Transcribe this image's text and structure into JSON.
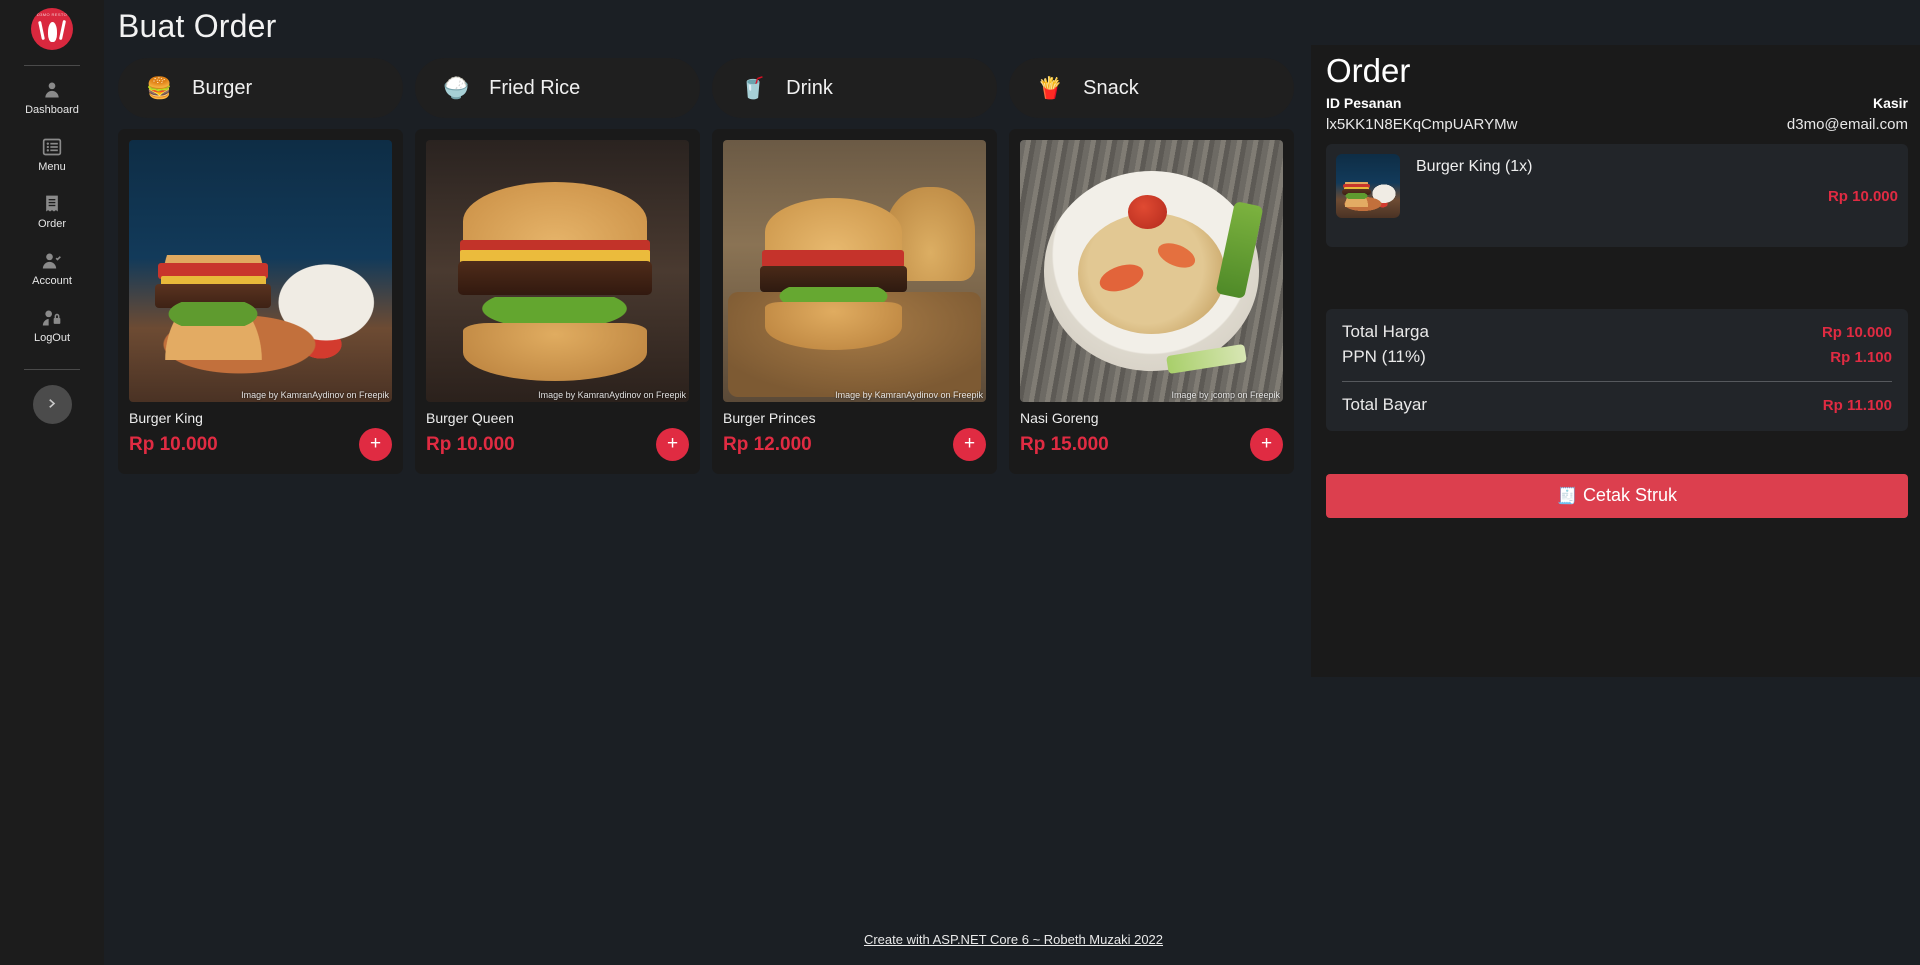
{
  "sidebar": {
    "logo_name": "restaurant-logo",
    "logo_arc_text": "D3MO RESTO",
    "items": [
      {
        "label": "Dashboard",
        "icon": "user-icon"
      },
      {
        "label": "Menu",
        "icon": "list-icon"
      },
      {
        "label": "Order",
        "icon": "receipt-icon"
      },
      {
        "label": "Account",
        "icon": "user-check-icon"
      },
      {
        "label": "LogOut",
        "icon": "user-lock-icon"
      }
    ],
    "collapse_icon": "chevron-right-icon"
  },
  "page": {
    "title": "Buat Order"
  },
  "categories": [
    {
      "label": "Burger",
      "emoji": "🍔",
      "icon": "burger-icon"
    },
    {
      "label": "Fried Rice",
      "emoji": "🍚",
      "icon": "fried-rice-icon"
    },
    {
      "label": "Drink",
      "emoji": "🥤",
      "icon": "drink-icon"
    },
    {
      "label": "Snack",
      "emoji": "🍟",
      "icon": "snack-icon"
    }
  ],
  "products": [
    {
      "name": "Burger King",
      "price": "Rp 10.000",
      "credit": "Image by KamranAydinov on Freepik",
      "add_label": "+"
    },
    {
      "name": "Burger Queen",
      "price": "Rp 10.000",
      "credit": "Image by KamranAydinov on Freepik",
      "add_label": "+"
    },
    {
      "name": "Burger Princes",
      "price": "Rp 12.000",
      "credit": "Image by KamranAydinov on Freepik",
      "add_label": "+"
    },
    {
      "name": "Nasi Goreng",
      "price": "Rp 15.000",
      "credit": "Image by jcomp on Freepik",
      "add_label": "+"
    }
  ],
  "order": {
    "title": "Order",
    "id_label": "ID Pesanan",
    "id_value": "lx5KK1N8EKqCmpUARYMw",
    "role_label": "Kasir",
    "role_email": "d3mo@email.com",
    "items": [
      {
        "name": "Burger King (1x)",
        "price": "Rp 10.000"
      }
    ],
    "totals": {
      "subtotal_label": "Total Harga",
      "subtotal_value": "Rp 10.000",
      "tax_label": "PPN (11%)",
      "tax_value": "Rp 1.100",
      "grand_label": "Total Bayar",
      "grand_value": "Rp 11.100"
    },
    "print_button": "Cetak Struk",
    "print_icon": "receipt-icon"
  },
  "footer": {
    "text": "Create with ASP.NET Core 6 ~ Robeth Muzaki 2022"
  },
  "colors": {
    "accent_red": "#e02b42",
    "button_red": "#dc3f4e",
    "page_bg": "#1b1f24",
    "panel_bg": "#1a1a1a",
    "card_bg": "#1f1f1f"
  }
}
